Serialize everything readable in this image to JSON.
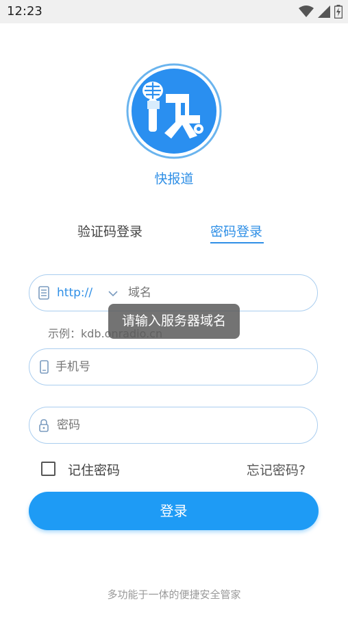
{
  "status_bar": {
    "time": "12:23",
    "icons": [
      "wifi-icon",
      "signal-icon",
      "battery-charging-icon"
    ]
  },
  "app": {
    "logo_glyph": "快",
    "name": "快报道"
  },
  "tabs": [
    {
      "label": "验证码登录",
      "active": false
    },
    {
      "label": "密码登录",
      "active": true
    }
  ],
  "form": {
    "domain": {
      "protocol": "http://",
      "placeholder": "域名",
      "example": "示例：kdb.onradio.cn"
    },
    "phone": {
      "placeholder": "手机号"
    },
    "password": {
      "placeholder": "密码"
    },
    "remember_label": "记住密码",
    "forgot_label": "忘记密码?",
    "login_label": "登录"
  },
  "toast": {
    "message": "请输入服务器域名"
  },
  "footer": {
    "tagline": "多功能于一体的便捷安全管家"
  },
  "colors": {
    "accent": "#2f8fe6",
    "button": "#1e9bf5",
    "field_border": "#a9cdef"
  }
}
